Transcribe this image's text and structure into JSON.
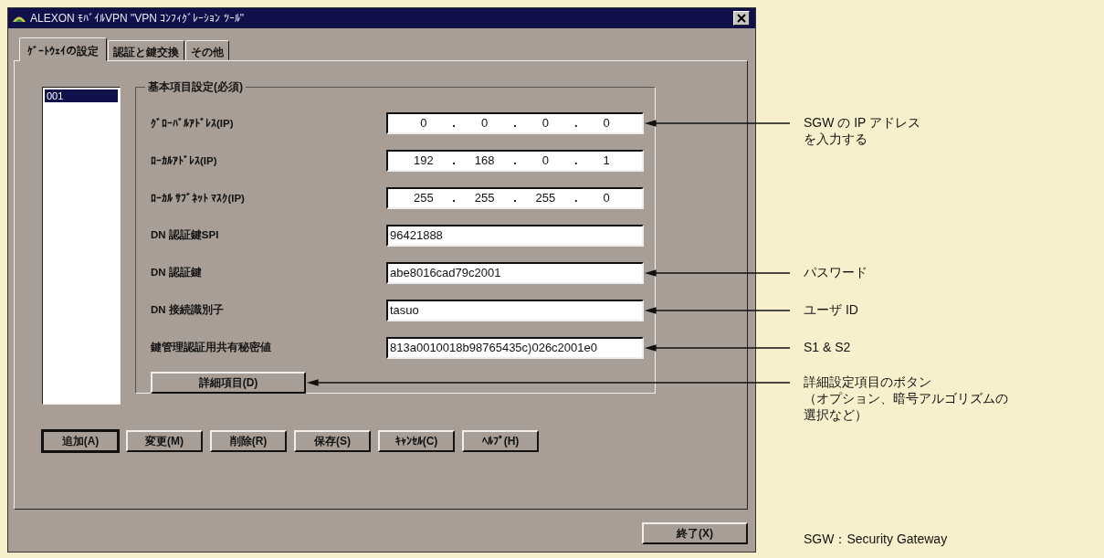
{
  "window": {
    "title": "ALEXON ﾓﾊﾞｲﾙVPN \"VPN ｺﾝﾌｨｸﾞﾚｰｼｮﾝ ﾂｰﾙ\""
  },
  "tabs": [
    {
      "label": "ｹﾞｰﾄｳｪｲの設定",
      "selected": true
    },
    {
      "label": "認証と鍵交換",
      "selected": false
    },
    {
      "label": "その他",
      "selected": false
    }
  ],
  "gateway_list": {
    "items": [
      {
        "label": "001",
        "selected": true
      }
    ]
  },
  "group": {
    "title": "基本項目設定(必須)",
    "fields": [
      {
        "kind": "ip",
        "label": "ｸﾞﾛｰﾊﾞﾙｱﾄﾞﾚｽ(IP)",
        "octets": [
          "0",
          "0",
          "0",
          "0"
        ],
        "separator": ".",
        "annotation": [
          "SGW の IP アドレス",
          "を入力する"
        ]
      },
      {
        "kind": "ip",
        "label": "ﾛｰｶﾙｱﾄﾞﾚｽ(IP)",
        "octets": [
          "192",
          "168",
          "0",
          "1"
        ],
        "separator": "."
      },
      {
        "kind": "ip",
        "label": "ﾛｰｶﾙ ｻﾌﾞﾈｯﾄ ﾏｽｸ(IP)",
        "octets": [
          "255",
          "255",
          "255",
          "0"
        ],
        "separator": "."
      },
      {
        "kind": "text",
        "label": "DN 認証鍵SPI",
        "value": "96421888"
      },
      {
        "kind": "text",
        "label": "DN 認証鍵",
        "value": "abe8016cad79c2001",
        "annotation": [
          "パスワード"
        ]
      },
      {
        "kind": "text",
        "label": "DN 接続識別子",
        "value": "tasuo",
        "annotation": [
          "ユーザ ID"
        ]
      },
      {
        "kind": "text",
        "label": "鍵管理認証用共有秘密値",
        "value": "813a0010018b98765435c)026c2001e0",
        "annotation": [
          "S1 & S2"
        ]
      }
    ],
    "detail_button": {
      "label": "詳細項目(D)",
      "annotation": [
        "詳細設定項目のボタン",
        "（オプション、暗号アルゴリズムの",
        "選択など）"
      ]
    }
  },
  "buttons": [
    "追加(A)",
    "変更(M)",
    "削除(R)",
    "保存(S)",
    "ｷｬﾝｾﾙ(C)",
    "ﾍﾙﾌﾟ(H)"
  ],
  "exit_button": "終了(X)",
  "footnote": "SGW：Security Gateway"
}
